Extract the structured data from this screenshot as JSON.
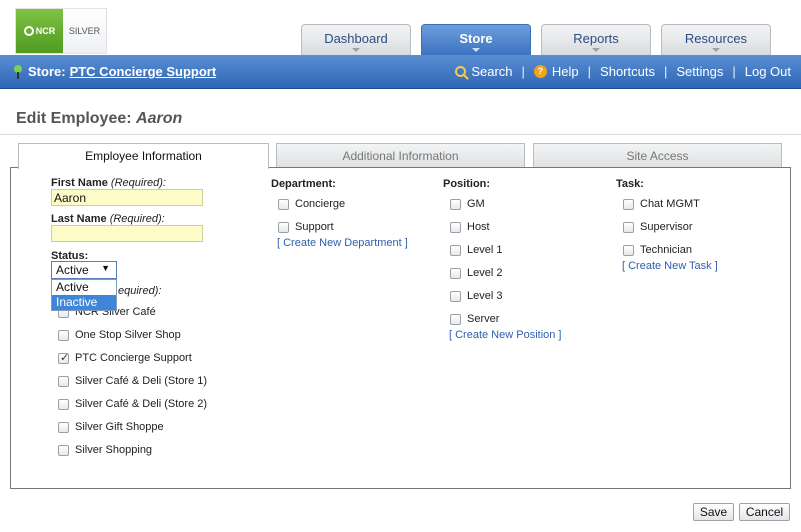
{
  "header": {
    "logo": {
      "ncr": "NCR",
      "silver": "SILVER"
    },
    "tabs": [
      {
        "label": "Dashboard",
        "active": false
      },
      {
        "label": "Store",
        "active": true
      },
      {
        "label": "Reports",
        "active": false
      },
      {
        "label": "Resources",
        "active": false
      }
    ]
  },
  "navbar": {
    "store_prefix": "Store:",
    "store_name": "PTC Concierge Support",
    "links": {
      "search": "Search",
      "help": "Help",
      "shortcuts": "Shortcuts",
      "settings": "Settings",
      "logout": "Log Out"
    },
    "separator": "|"
  },
  "page": {
    "title_prefix": "Edit Employee:",
    "employee_name": "Aaron"
  },
  "content_tabs": [
    {
      "label": "Employee Information",
      "active": true
    },
    {
      "label": "Additional Information",
      "active": false
    },
    {
      "label": "Site Access",
      "active": false
    }
  ],
  "form": {
    "first_name": {
      "label": "First Name",
      "req": "(Required)",
      "colon": ":",
      "value": "Aaron"
    },
    "last_name": {
      "label": "Last Name",
      "req": "(Required)",
      "colon": ":",
      "value": ""
    },
    "status": {
      "label": "Status:",
      "selected": "Active",
      "caret": "▼",
      "options": [
        "Active",
        "Inactive"
      ],
      "highlighted": "Inactive"
    },
    "stores_label_tail": "equired):",
    "stores": [
      {
        "name": "NCR Silver Café",
        "checked": false
      },
      {
        "name": "One Stop Silver Shop",
        "checked": false
      },
      {
        "name": "PTC Concierge Support",
        "checked": true
      },
      {
        "name": "Silver Café & Deli (Store 1)",
        "checked": false
      },
      {
        "name": "Silver Café & Deli (Store 2)",
        "checked": false
      },
      {
        "name": "Silver Gift Shoppe",
        "checked": false
      },
      {
        "name": "Silver Shopping",
        "checked": false
      }
    ],
    "department": {
      "label": "Department:",
      "items": [
        {
          "name": "Concierge",
          "checked": false
        },
        {
          "name": "Support",
          "checked": false
        }
      ],
      "create_link": "[ Create New Department ]"
    },
    "position": {
      "label": "Position:",
      "items": [
        {
          "name": "GM",
          "checked": false
        },
        {
          "name": "Host",
          "checked": false
        },
        {
          "name": "Level 1",
          "checked": false
        },
        {
          "name": "Level 2",
          "checked": false
        },
        {
          "name": "Level 3",
          "checked": false
        },
        {
          "name": "Server",
          "checked": false
        }
      ],
      "create_link": "[ Create New Position ]"
    },
    "task": {
      "label": "Task:",
      "items": [
        {
          "name": "Chat MGMT",
          "checked": false
        },
        {
          "name": "Supervisor",
          "checked": false
        },
        {
          "name": "Technician",
          "checked": false
        }
      ],
      "create_link": "[ Create New Task ]"
    }
  },
  "buttons": {
    "save": "Save",
    "cancel": "Cancel"
  }
}
